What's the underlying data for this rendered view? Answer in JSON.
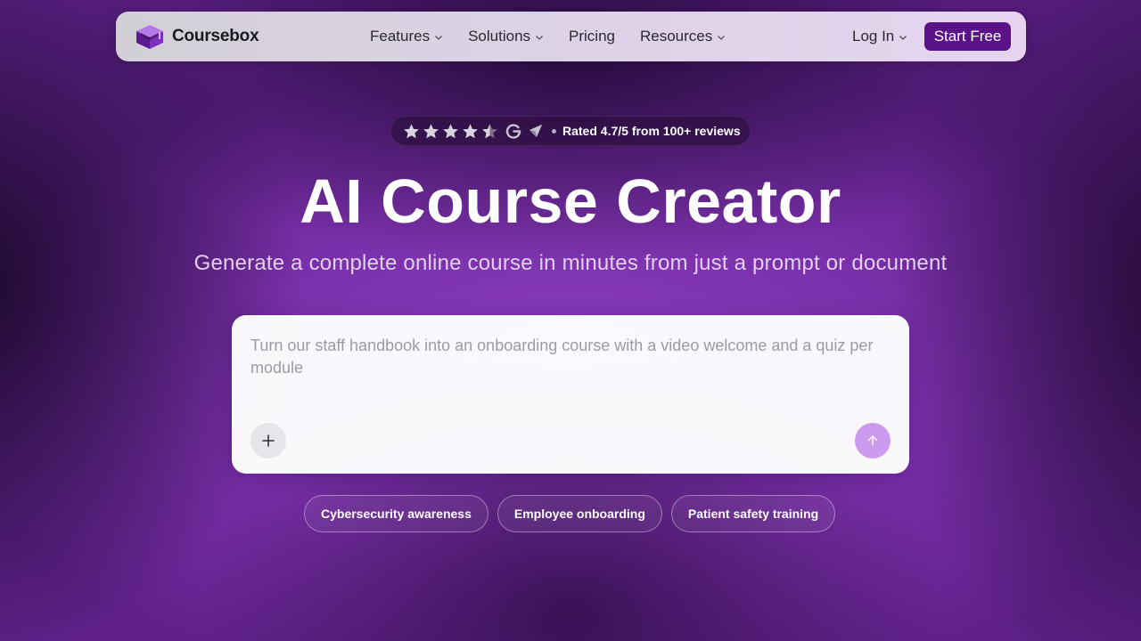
{
  "nav": {
    "logo_text": "Coursebox",
    "links": [
      {
        "label": "Features",
        "has_dropdown": true
      },
      {
        "label": "Solutions",
        "has_dropdown": true
      },
      {
        "label": "Pricing",
        "has_dropdown": false
      },
      {
        "label": "Resources",
        "has_dropdown": true
      }
    ],
    "login_label": "Log In",
    "start_label": "Start Free"
  },
  "rating": {
    "stars": 4.5,
    "text": "Rated 4.7/5 from 100+ reviews",
    "icons": [
      "star-icon",
      "google-g-icon",
      "capterra-icon"
    ]
  },
  "hero": {
    "title": "AI Course Creator",
    "subtitle": "Generate a complete online course in minutes from just a prompt or document"
  },
  "prompt": {
    "placeholder": "Turn our staff handbook into an onboarding course with a video welcome and a quiz per module",
    "value": ""
  },
  "chips": [
    {
      "label": "Cybersecurity awareness"
    },
    {
      "label": "Employee onboarding"
    },
    {
      "label": "Patient safety training"
    }
  ],
  "colors": {
    "accent": "#5b1289",
    "send_button": "#cc9bf0",
    "background": "#7a30aa"
  }
}
